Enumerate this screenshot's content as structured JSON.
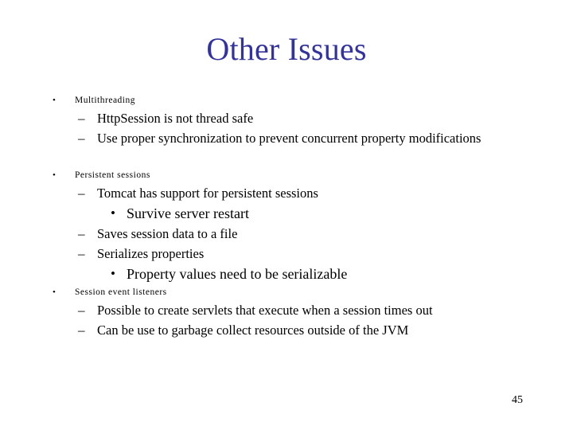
{
  "slide": {
    "title": "Other Issues",
    "title_color": "#333399",
    "background_color": "#ffffff",
    "text_color": "#000000",
    "page_number": "45"
  },
  "markers": {
    "level1": "•",
    "level2": "–",
    "level3": "•"
  },
  "content": {
    "groups": [
      {
        "heading": "Multithreading",
        "items": [
          {
            "level": 2,
            "text": "HttpSession is not thread safe"
          },
          {
            "level": 2,
            "text": "Use proper synchronization to prevent concurrent property modifications"
          }
        ]
      },
      {
        "heading": "Persistent sessions",
        "items": [
          {
            "level": 2,
            "text": "Tomcat has support for persistent sessions"
          },
          {
            "level": 3,
            "text": "Survive server restart"
          },
          {
            "level": 2,
            "text": "Saves session data to a file"
          },
          {
            "level": 2,
            "text": "Serializes properties"
          },
          {
            "level": 3,
            "text": "Property values need to be serializable"
          }
        ]
      },
      {
        "heading": "Session event listeners",
        "items": [
          {
            "level": 2,
            "text": "Possible to create servlets that execute when a session times out"
          },
          {
            "level": 2,
            "text": "Can be use to garbage collect resources outside of the JVM"
          }
        ]
      }
    ]
  }
}
